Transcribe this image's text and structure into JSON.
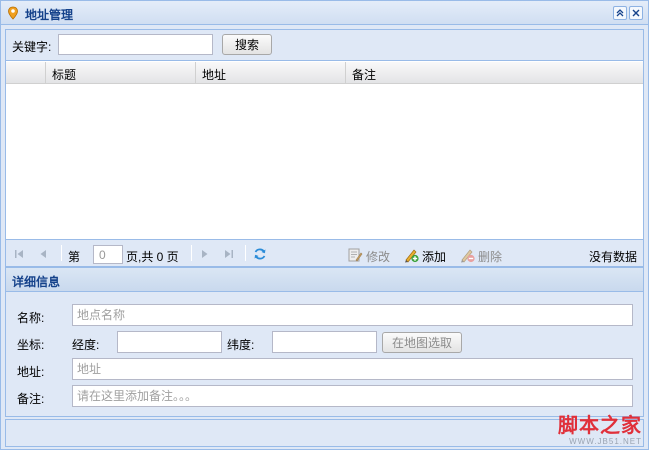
{
  "window": {
    "title": "地址管理",
    "icon": "location-pin-icon"
  },
  "search": {
    "label": "关键字:",
    "value": "",
    "button": "搜索"
  },
  "grid": {
    "columns": [
      "标题",
      "地址",
      "备注"
    ],
    "rows": []
  },
  "pager": {
    "page_prefix": "第",
    "page_value": "0",
    "page_suffix": "页,共 0 页",
    "edit_label": "修改",
    "add_label": "添加",
    "delete_label": "删除",
    "status": "没有数据"
  },
  "details": {
    "title": "详细信息",
    "name_label": "名称:",
    "name_placeholder": "地点名称",
    "coord_label": "坐标:",
    "lng_label": "经度:",
    "lat_label": "纬度:",
    "map_pick_button": "在地图选取",
    "address_label": "地址:",
    "address_placeholder": "地址",
    "note_label": "备注:",
    "note_placeholder": "请在这里添加备注。。。"
  },
  "watermark": {
    "main": "脚本之家",
    "sub": "WWW.JB51.NET"
  },
  "colors": {
    "title_text": "#15428b",
    "panel_border": "#99bbe8",
    "panel_bg": "#dfe8f6",
    "watermark": "#e0303a"
  }
}
